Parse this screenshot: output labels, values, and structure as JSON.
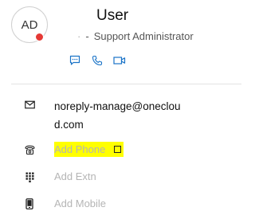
{
  "user": {
    "initials": "AD",
    "name": "User",
    "role_dot": "·",
    "role_dash": "-",
    "role": "Support Administrator",
    "presence_color": "#e53935"
  },
  "actions": [
    {
      "name": "chat",
      "icon": "chat-icon"
    },
    {
      "name": "call",
      "icon": "phone-icon"
    },
    {
      "name": "video",
      "icon": "video-icon"
    }
  ],
  "contact": {
    "email": "noreply-manage@onecloud.com",
    "phone_placeholder": "Add Phone",
    "extn_placeholder": "Add Extn",
    "mobile_placeholder": "Add Mobile"
  },
  "colors": {
    "accent": "#1a73c7",
    "highlight": "#ffff00",
    "placeholder": "#b5b5b5"
  }
}
